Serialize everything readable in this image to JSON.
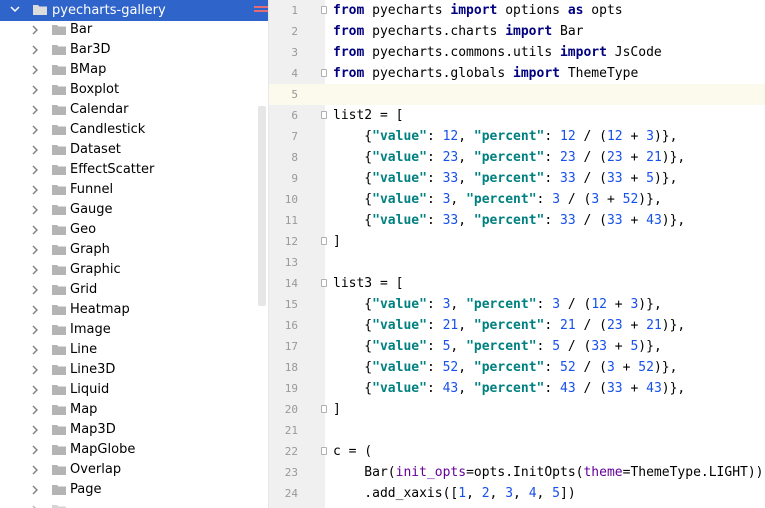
{
  "tree": {
    "root": {
      "label": "pyecharts-gallery",
      "icon": "folder-icon",
      "expanded": true
    },
    "items": [
      {
        "label": "Bar"
      },
      {
        "label": "Bar3D"
      },
      {
        "label": "BMap"
      },
      {
        "label": "Boxplot"
      },
      {
        "label": "Calendar"
      },
      {
        "label": "Candlestick"
      },
      {
        "label": "Dataset"
      },
      {
        "label": "EffectScatter"
      },
      {
        "label": "Funnel"
      },
      {
        "label": "Gauge"
      },
      {
        "label": "Geo"
      },
      {
        "label": "Graph"
      },
      {
        "label": "Graphic"
      },
      {
        "label": "Grid"
      },
      {
        "label": "Heatmap"
      },
      {
        "label": "Image"
      },
      {
        "label": "Line"
      },
      {
        "label": "Line3D"
      },
      {
        "label": "Liquid"
      },
      {
        "label": "Map"
      },
      {
        "label": "Map3D"
      },
      {
        "label": "MapGlobe"
      },
      {
        "label": "Overlap"
      },
      {
        "label": "Page"
      },
      {
        "label": "Parallel"
      }
    ]
  },
  "editor": {
    "current_line": 5,
    "colors": {
      "keyword": "#000080",
      "string": "#008080",
      "number": "#1750eb",
      "param": "#660099",
      "gutter": "#f0f0f0",
      "current_line": "#fcfaed",
      "selection": "#2f65ca"
    },
    "lines": [
      {
        "n": "1",
        "fold": true,
        "tokens": [
          [
            "kw",
            "from"
          ],
          [
            "t",
            " pyecharts "
          ],
          [
            "kw",
            "import"
          ],
          [
            "t",
            " options "
          ],
          [
            "kw",
            "as"
          ],
          [
            "t",
            " opts"
          ]
        ]
      },
      {
        "n": "2",
        "fold": false,
        "tokens": [
          [
            "kw",
            "from"
          ],
          [
            "t",
            " pyecharts.charts "
          ],
          [
            "kw",
            "import"
          ],
          [
            "t",
            " Bar"
          ]
        ]
      },
      {
        "n": "3",
        "fold": false,
        "tokens": [
          [
            "kw",
            "from"
          ],
          [
            "t",
            " pyecharts.commons.utils "
          ],
          [
            "kw",
            "import"
          ],
          [
            "t",
            " JsCode"
          ]
        ]
      },
      {
        "n": "4",
        "fold": true,
        "tokens": [
          [
            "kw",
            "from"
          ],
          [
            "t",
            " pyecharts.globals "
          ],
          [
            "kw",
            "import"
          ],
          [
            "t",
            " ThemeType"
          ]
        ]
      },
      {
        "n": "5",
        "fold": false,
        "tokens": []
      },
      {
        "n": "6",
        "fold": true,
        "tokens": [
          [
            "t",
            "list2 = ["
          ]
        ]
      },
      {
        "n": "7",
        "fold": false,
        "tokens": [
          [
            "t",
            "    {"
          ],
          [
            "str",
            "\"value\""
          ],
          [
            "t",
            ": "
          ],
          [
            "num",
            "12"
          ],
          [
            "t",
            ", "
          ],
          [
            "str",
            "\"percent\""
          ],
          [
            "t",
            ": "
          ],
          [
            "num",
            "12"
          ],
          [
            "t",
            " / ("
          ],
          [
            "num",
            "12"
          ],
          [
            "t",
            " + "
          ],
          [
            "num",
            "3"
          ],
          [
            "t",
            ")},"
          ]
        ]
      },
      {
        "n": "8",
        "fold": false,
        "tokens": [
          [
            "t",
            "    {"
          ],
          [
            "str",
            "\"value\""
          ],
          [
            "t",
            ": "
          ],
          [
            "num",
            "23"
          ],
          [
            "t",
            ", "
          ],
          [
            "str",
            "\"percent\""
          ],
          [
            "t",
            ": "
          ],
          [
            "num",
            "23"
          ],
          [
            "t",
            " / ("
          ],
          [
            "num",
            "23"
          ],
          [
            "t",
            " + "
          ],
          [
            "num",
            "21"
          ],
          [
            "t",
            ")},"
          ]
        ]
      },
      {
        "n": "9",
        "fold": false,
        "tokens": [
          [
            "t",
            "    {"
          ],
          [
            "str",
            "\"value\""
          ],
          [
            "t",
            ": "
          ],
          [
            "num",
            "33"
          ],
          [
            "t",
            ", "
          ],
          [
            "str",
            "\"percent\""
          ],
          [
            "t",
            ": "
          ],
          [
            "num",
            "33"
          ],
          [
            "t",
            " / ("
          ],
          [
            "num",
            "33"
          ],
          [
            "t",
            " + "
          ],
          [
            "num",
            "5"
          ],
          [
            "t",
            ")},"
          ]
        ]
      },
      {
        "n": "10",
        "fold": false,
        "tokens": [
          [
            "t",
            "    {"
          ],
          [
            "str",
            "\"value\""
          ],
          [
            "t",
            ": "
          ],
          [
            "num",
            "3"
          ],
          [
            "t",
            ", "
          ],
          [
            "str",
            "\"percent\""
          ],
          [
            "t",
            ": "
          ],
          [
            "num",
            "3"
          ],
          [
            "t",
            " / ("
          ],
          [
            "num",
            "3"
          ],
          [
            "t",
            " + "
          ],
          [
            "num",
            "52"
          ],
          [
            "t",
            ")},"
          ]
        ]
      },
      {
        "n": "11",
        "fold": false,
        "tokens": [
          [
            "t",
            "    {"
          ],
          [
            "str",
            "\"value\""
          ],
          [
            "t",
            ": "
          ],
          [
            "num",
            "33"
          ],
          [
            "t",
            ", "
          ],
          [
            "str",
            "\"percent\""
          ],
          [
            "t",
            ": "
          ],
          [
            "num",
            "33"
          ],
          [
            "t",
            " / ("
          ],
          [
            "num",
            "33"
          ],
          [
            "t",
            " + "
          ],
          [
            "num",
            "43"
          ],
          [
            "t",
            ")},"
          ]
        ]
      },
      {
        "n": "12",
        "fold": true,
        "tokens": [
          [
            "t",
            "]"
          ]
        ]
      },
      {
        "n": "13",
        "fold": false,
        "tokens": []
      },
      {
        "n": "14",
        "fold": true,
        "tokens": [
          [
            "t",
            "list3 = ["
          ]
        ]
      },
      {
        "n": "15",
        "fold": false,
        "tokens": [
          [
            "t",
            "    {"
          ],
          [
            "str",
            "\"value\""
          ],
          [
            "t",
            ": "
          ],
          [
            "num",
            "3"
          ],
          [
            "t",
            ", "
          ],
          [
            "str",
            "\"percent\""
          ],
          [
            "t",
            ": "
          ],
          [
            "num",
            "3"
          ],
          [
            "t",
            " / ("
          ],
          [
            "num",
            "12"
          ],
          [
            "t",
            " + "
          ],
          [
            "num",
            "3"
          ],
          [
            "t",
            ")},"
          ]
        ]
      },
      {
        "n": "16",
        "fold": false,
        "tokens": [
          [
            "t",
            "    {"
          ],
          [
            "str",
            "\"value\""
          ],
          [
            "t",
            ": "
          ],
          [
            "num",
            "21"
          ],
          [
            "t",
            ", "
          ],
          [
            "str",
            "\"percent\""
          ],
          [
            "t",
            ": "
          ],
          [
            "num",
            "21"
          ],
          [
            "t",
            " / ("
          ],
          [
            "num",
            "23"
          ],
          [
            "t",
            " + "
          ],
          [
            "num",
            "21"
          ],
          [
            "t",
            ")},"
          ]
        ]
      },
      {
        "n": "17",
        "fold": false,
        "tokens": [
          [
            "t",
            "    {"
          ],
          [
            "str",
            "\"value\""
          ],
          [
            "t",
            ": "
          ],
          [
            "num",
            "5"
          ],
          [
            "t",
            ", "
          ],
          [
            "str",
            "\"percent\""
          ],
          [
            "t",
            ": "
          ],
          [
            "num",
            "5"
          ],
          [
            "t",
            " / ("
          ],
          [
            "num",
            "33"
          ],
          [
            "t",
            " + "
          ],
          [
            "num",
            "5"
          ],
          [
            "t",
            ")},"
          ]
        ]
      },
      {
        "n": "18",
        "fold": false,
        "tokens": [
          [
            "t",
            "    {"
          ],
          [
            "str",
            "\"value\""
          ],
          [
            "t",
            ": "
          ],
          [
            "num",
            "52"
          ],
          [
            "t",
            ", "
          ],
          [
            "str",
            "\"percent\""
          ],
          [
            "t",
            ": "
          ],
          [
            "num",
            "52"
          ],
          [
            "t",
            " / ("
          ],
          [
            "num",
            "3"
          ],
          [
            "t",
            " + "
          ],
          [
            "num",
            "52"
          ],
          [
            "t",
            ")},"
          ]
        ]
      },
      {
        "n": "19",
        "fold": false,
        "tokens": [
          [
            "t",
            "    {"
          ],
          [
            "str",
            "\"value\""
          ],
          [
            "t",
            ": "
          ],
          [
            "num",
            "43"
          ],
          [
            "t",
            ", "
          ],
          [
            "str",
            "\"percent\""
          ],
          [
            "t",
            ": "
          ],
          [
            "num",
            "43"
          ],
          [
            "t",
            " / ("
          ],
          [
            "num",
            "33"
          ],
          [
            "t",
            " + "
          ],
          [
            "num",
            "43"
          ],
          [
            "t",
            ")},"
          ]
        ]
      },
      {
        "n": "20",
        "fold": true,
        "tokens": [
          [
            "t",
            "]"
          ]
        ]
      },
      {
        "n": "21",
        "fold": false,
        "tokens": []
      },
      {
        "n": "22",
        "fold": true,
        "tokens": [
          [
            "t",
            "c = ("
          ]
        ]
      },
      {
        "n": "23",
        "fold": false,
        "tokens": [
          [
            "t",
            "    Bar("
          ],
          [
            "param",
            "init_opts"
          ],
          [
            "t",
            "=opts.InitOpts("
          ],
          [
            "param",
            "theme"
          ],
          [
            "t",
            "=ThemeType.LIGHT))"
          ]
        ]
      },
      {
        "n": "24",
        "fold": false,
        "tokens": [
          [
            "t",
            "    .add_xaxis(["
          ],
          [
            "num",
            "1"
          ],
          [
            "t",
            ", "
          ],
          [
            "num",
            "2"
          ],
          [
            "t",
            ", "
          ],
          [
            "num",
            "3"
          ],
          [
            "t",
            ", "
          ],
          [
            "num",
            "4"
          ],
          [
            "t",
            ", "
          ],
          [
            "num",
            "5"
          ],
          [
            "t",
            "])"
          ]
        ]
      }
    ]
  }
}
